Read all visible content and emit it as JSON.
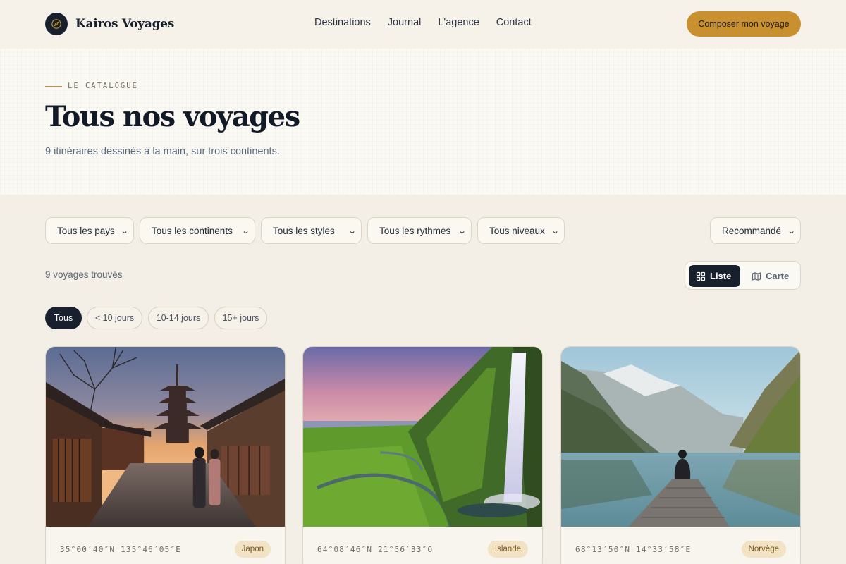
{
  "brand": {
    "name": "Kairos Voyages",
    "logo_icon": "compass-icon"
  },
  "nav": [
    "Destinations",
    "Journal",
    "L'agence",
    "Contact"
  ],
  "cta_label": "Composer mon voyage",
  "hero": {
    "eyebrow": "LE CATALOGUE",
    "title": "Tous nos voyages",
    "subtitle": "9 itinéraires dessinés à la main, sur trois continents."
  },
  "filters": [
    "Tous les pays",
    "Tous les continents",
    "Tous les styles",
    "Tous les rythmes",
    "Tous niveaux"
  ],
  "sort": "Recommandé",
  "results_count": "9 voyages trouvés",
  "view_toggle": {
    "list": "Liste",
    "map": "Carte",
    "active": "Liste"
  },
  "duration_chips": [
    "Tous",
    "< 10 jours",
    "10-14 jours",
    "15+ jours"
  ],
  "active_chip": "Tous",
  "cards": [
    {
      "coords": "35°00′40″N 135°46′05″E",
      "country": "Japon",
      "image": "kyoto-pagoda-street"
    },
    {
      "coords": "64°08′46″N 21°56′33″O",
      "country": "Islande",
      "image": "waterfall-green-valley"
    },
    {
      "coords": "68°13′50″N 14°33′58″E",
      "country": "Norvège",
      "image": "fjord-pier-lake"
    }
  ],
  "colors": {
    "accent": "#c8902f",
    "dark": "#17202c",
    "bg": "#f4efe6"
  }
}
